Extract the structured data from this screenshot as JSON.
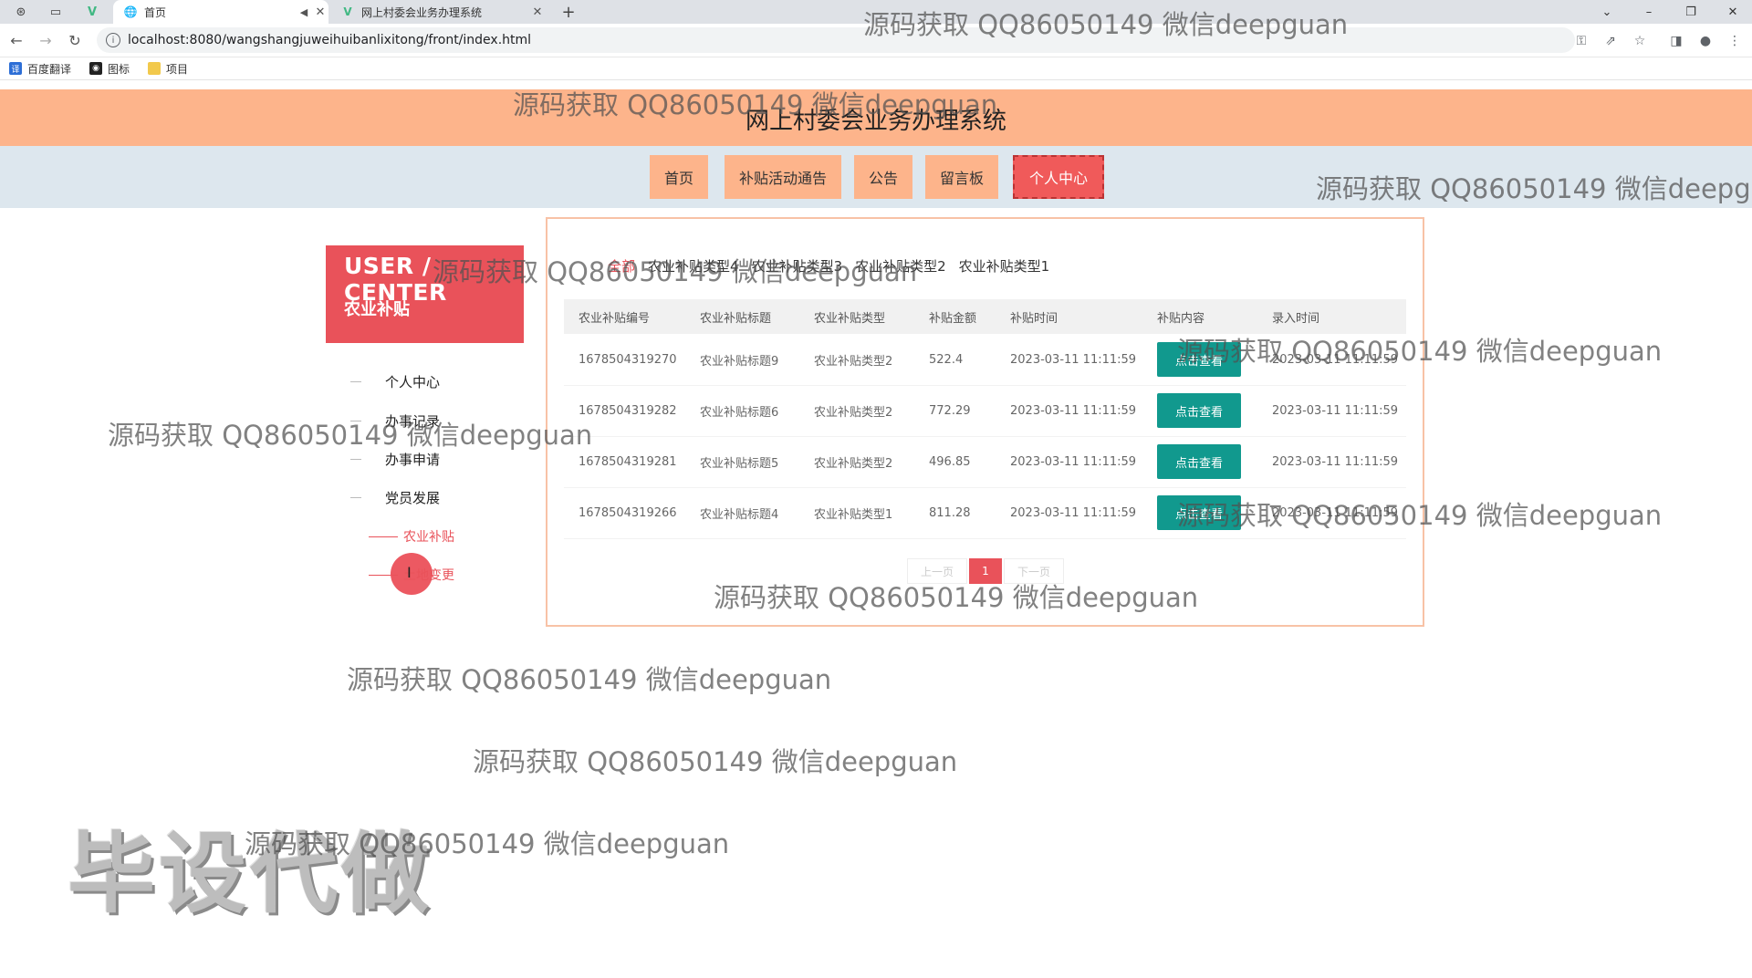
{
  "browser": {
    "tabs": [
      {
        "title": "首页",
        "icon": "globe-icon"
      },
      {
        "title": "网上村委会业务办理系统",
        "icon": "vue-icon"
      }
    ],
    "url": "localhost:8080/wangshangjuweihuibanlixitong/front/index.html",
    "bookmarks": [
      {
        "label": "百度翻译",
        "icon": "baidu-translate-icon",
        "color": "#2d6ed6"
      },
      {
        "label": "图标",
        "icon": "iconfont-icon",
        "color": "#222222"
      },
      {
        "label": "项目",
        "icon": "folder-icon",
        "color": "#f2c94c"
      }
    ]
  },
  "site": {
    "title": "网上村委会业务办理系统",
    "nav": [
      "首页",
      "补贴活动通告",
      "公告",
      "留言板",
      "个人中心"
    ],
    "nav_active": "个人中心"
  },
  "sidebar": {
    "title_en": "USER / CENTER",
    "title_cn": "农业补贴",
    "items": [
      "个人中心",
      "办事记录",
      "办事申请",
      "党员发展"
    ],
    "subitems": [
      "农业补贴",
      "土地变更"
    ],
    "active_sub": "农业补贴"
  },
  "filters": [
    "全部",
    "农业补贴类型4",
    "农业补贴类型3",
    "农业补贴类型2",
    "农业补贴类型1"
  ],
  "table": {
    "headers": [
      "农业补贴编号",
      "农业补贴标题",
      "农业补贴类型",
      "补贴金额",
      "补贴时间",
      "补贴内容",
      "录入时间"
    ],
    "button_label": "点击查看",
    "rows": [
      [
        "1678504319270",
        "农业补贴标题9",
        "农业补贴类型2",
        "522.4",
        "2023-03-11 11:11:59",
        "2023-03-11 11:11:59"
      ],
      [
        "1678504319282",
        "农业补贴标题6",
        "农业补贴类型2",
        "772.29",
        "2023-03-11 11:11:59",
        "2023-03-11 11:11:59"
      ],
      [
        "1678504319281",
        "农业补贴标题5",
        "农业补贴类型2",
        "496.85",
        "2023-03-11 11:11:59",
        "2023-03-11 11:11:59"
      ],
      [
        "1678504319266",
        "农业补贴标题4",
        "农业补贴类型1",
        "811.28",
        "2023-03-11 11:11:59",
        "2023-03-11 11:11:59"
      ]
    ]
  },
  "pagination": {
    "prev": "上一页",
    "current": "1",
    "next": "下一页"
  },
  "watermark": {
    "text": "源码获取 QQ86050149 微信deepguan",
    "text_cut": "源码获取 QQ86050149 微信deepg",
    "stamp": "毕设代做"
  },
  "colors": {
    "header": "#fdb48b",
    "accent": "#e9525a",
    "button": "#11998e",
    "nav_bg": "#dde7ee"
  }
}
